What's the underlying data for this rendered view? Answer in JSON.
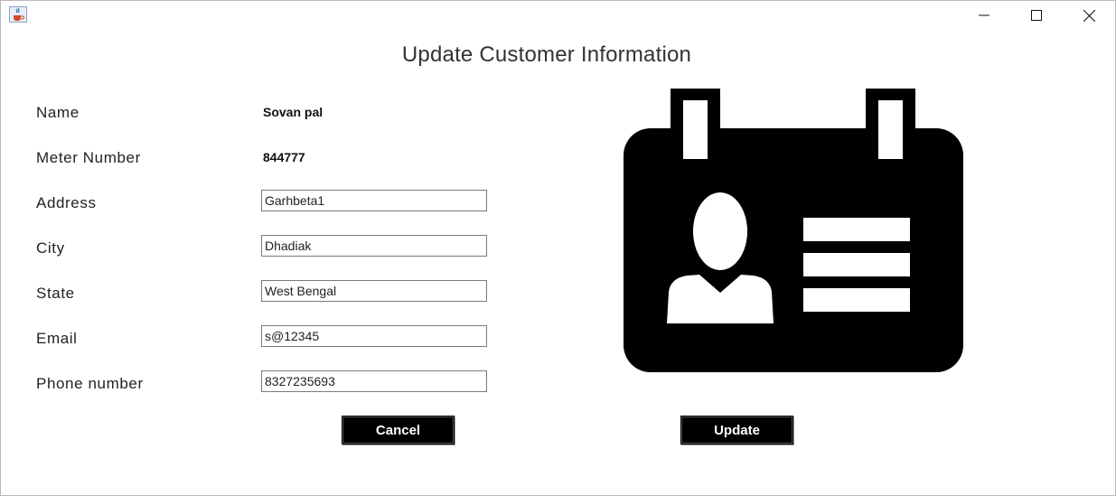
{
  "window": {
    "app_icon": "java-coffee-icon",
    "controls": [
      "minimize-icon",
      "maximize-icon",
      "close-icon"
    ]
  },
  "heading": "Update Customer Information",
  "form": {
    "name_label": "Name",
    "name_value": "Sovan pal",
    "meter_label": "Meter Number",
    "meter_value": "844777",
    "address_label": "Address",
    "address_value": "Garhbeta1",
    "city_label": "City",
    "city_value": "Dhadiak",
    "state_label": "State",
    "state_value": "West Bengal",
    "email_label": "Email",
    "email_value": "s@12345",
    "phone_label": "Phone number",
    "phone_value": "8327235693"
  },
  "buttons": {
    "cancel_label": "Cancel",
    "update_label": "Update"
  },
  "illustration": {
    "icon": "id-card-icon",
    "color": "#000000"
  }
}
